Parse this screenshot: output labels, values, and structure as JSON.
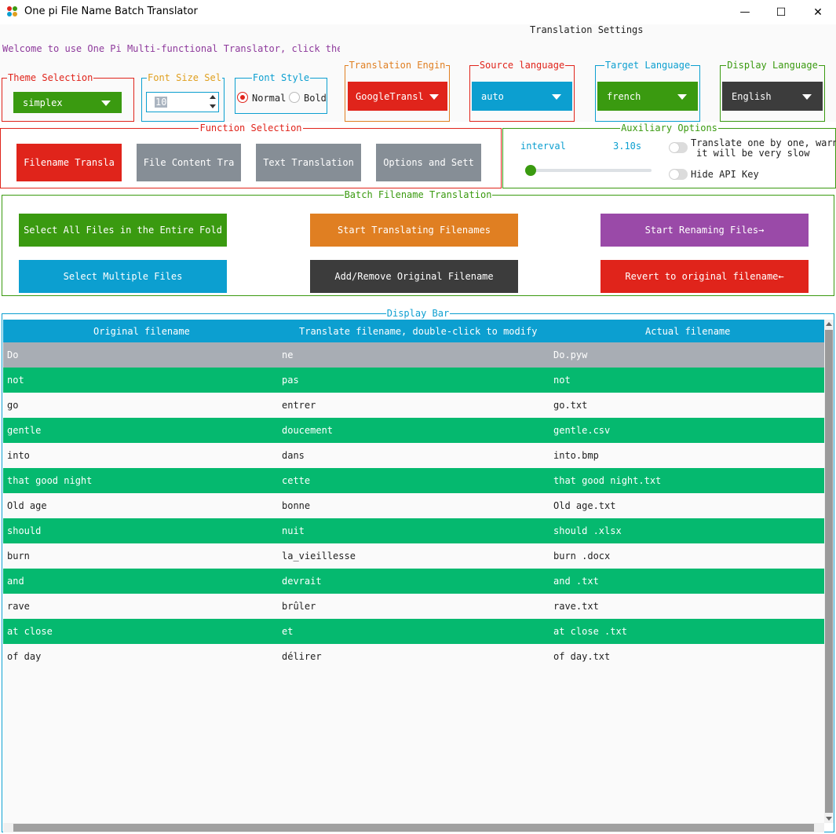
{
  "window": {
    "title": "One pi File Name Batch Translator",
    "minimize_glyph": "—",
    "maximize_glyph": "☐",
    "close_glyph": "✕"
  },
  "header": {
    "settings_heading": "Translation Settings",
    "welcome": "Welcome to use One Pi Multi-functional Translator, click the"
  },
  "settings": {
    "theme": {
      "legend": "Theme Selection",
      "value": "simplex"
    },
    "font_size": {
      "legend": "Font Size Sel",
      "value": "10"
    },
    "font_style": {
      "legend": "Font Style",
      "normal": "Normal",
      "bold": "Bold",
      "selected": "Normal"
    },
    "engine": {
      "legend": "Translation Engin",
      "value": "GoogleTransl"
    },
    "source": {
      "legend": "Source language",
      "value": "auto"
    },
    "target": {
      "legend": "Target Language",
      "value": "french"
    },
    "display": {
      "legend": "Display Language",
      "value": "English"
    }
  },
  "function_selection": {
    "legend": "Function Selection",
    "buttons": [
      "Filename Transla",
      "File Content Tra",
      "Text Translation",
      "Options and Sett"
    ]
  },
  "auxiliary": {
    "legend": "Auxiliary Options",
    "interval_label": "interval",
    "interval_value": "3.10s",
    "translate_one_by_one_line1": "Translate one by one, warni",
    "translate_one_by_one_line2": "it will be very slow",
    "hide_api_key": "Hide API Key"
  },
  "batch": {
    "legend": "Batch Filename Translation",
    "select_all": "Select All Files in the Entire Fold",
    "start_translating": "Start Translating Filenames",
    "start_renaming": "Start Renaming Files→",
    "select_multiple": "Select Multiple Files",
    "add_remove_original": "Add/Remove Original Filename",
    "revert": "Revert to original filename←"
  },
  "display_bar": {
    "legend": "Display Bar",
    "columns": [
      "Original filename",
      "Translate filename, double-click to modify",
      "Actual filename"
    ],
    "rows": [
      [
        "Do",
        "ne",
        "Do.pyw"
      ],
      [
        "not",
        "pas",
        "not"
      ],
      [
        "go",
        "entrer",
        "go.txt"
      ],
      [
        "gentle",
        "doucement",
        "gentle.csv"
      ],
      [
        "into",
        "dans",
        "into.bmp"
      ],
      [
        "that good night",
        "cette",
        "that good night.txt"
      ],
      [
        "Old age",
        "bonne",
        "Old age.txt"
      ],
      [
        "should",
        "nuit",
        "should .xlsx"
      ],
      [
        "burn",
        "la_vieillesse",
        "burn .docx"
      ],
      [
        "and",
        "devrait",
        "and .txt"
      ],
      [
        "rave",
        "brûler",
        "rave.txt"
      ],
      [
        "at close",
        "et",
        "at close .txt"
      ],
      [
        "of day",
        "délirer",
        "of day.txt"
      ]
    ]
  },
  "colors": {
    "red": "#e0241b",
    "green": "#3a9a10",
    "blue": "#0c9fd0",
    "orange": "#e07f22",
    "purple": "#9a4aa8",
    "dark": "#3c3c3c",
    "gray_button": "#868e96",
    "row_green": "#05b96f",
    "row_selected": "#a8adb4"
  }
}
